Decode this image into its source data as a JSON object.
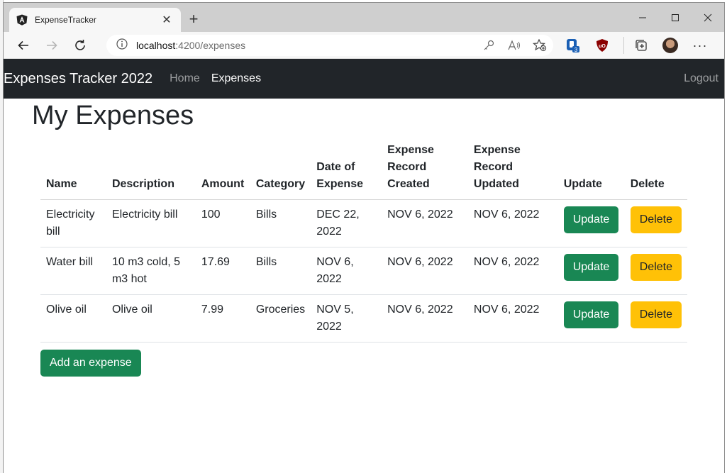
{
  "browser": {
    "tab_title": "ExpenseTracker",
    "url_host": "localhost",
    "url_rest": ":4200/expenses",
    "extension_badge": "3"
  },
  "navbar": {
    "brand": "Expenses Tracker 2022",
    "links": [
      "Home",
      "Expenses"
    ],
    "logout": "Logout"
  },
  "page": {
    "title": "My Expenses",
    "add_button": "Add an expense"
  },
  "table": {
    "headers": [
      "Name",
      "Description",
      "Amount",
      "Category",
      "Date of Expense",
      "Expense Record Created",
      "Expense Record Updated",
      "Update",
      "Delete"
    ],
    "rows": [
      {
        "name": "Electricity bill",
        "description": "Electricity bill",
        "amount": "100",
        "category": "Bills",
        "date": "DEC 22, 2022",
        "created": "NOV 6, 2022",
        "updated": "NOV 6, 2022",
        "update_label": "Update",
        "delete_label": "Delete"
      },
      {
        "name": "Water bill",
        "description": "10 m3 cold, 5 m3 hot",
        "amount": "17.69",
        "category": "Bills",
        "date": "NOV 6, 2022",
        "created": "NOV 6, 2022",
        "updated": "NOV 6, 2022",
        "update_label": "Update",
        "delete_label": "Delete"
      },
      {
        "name": "Olive oil",
        "description": "Olive oil",
        "amount": "7.99",
        "category": "Groceries",
        "date": "NOV 5, 2022",
        "created": "NOV 6, 2022",
        "updated": "NOV 6, 2022",
        "update_label": "Update",
        "delete_label": "Delete"
      }
    ]
  },
  "colors": {
    "navbar_bg": "#212529",
    "success": "#198754",
    "warning": "#ffc107"
  }
}
